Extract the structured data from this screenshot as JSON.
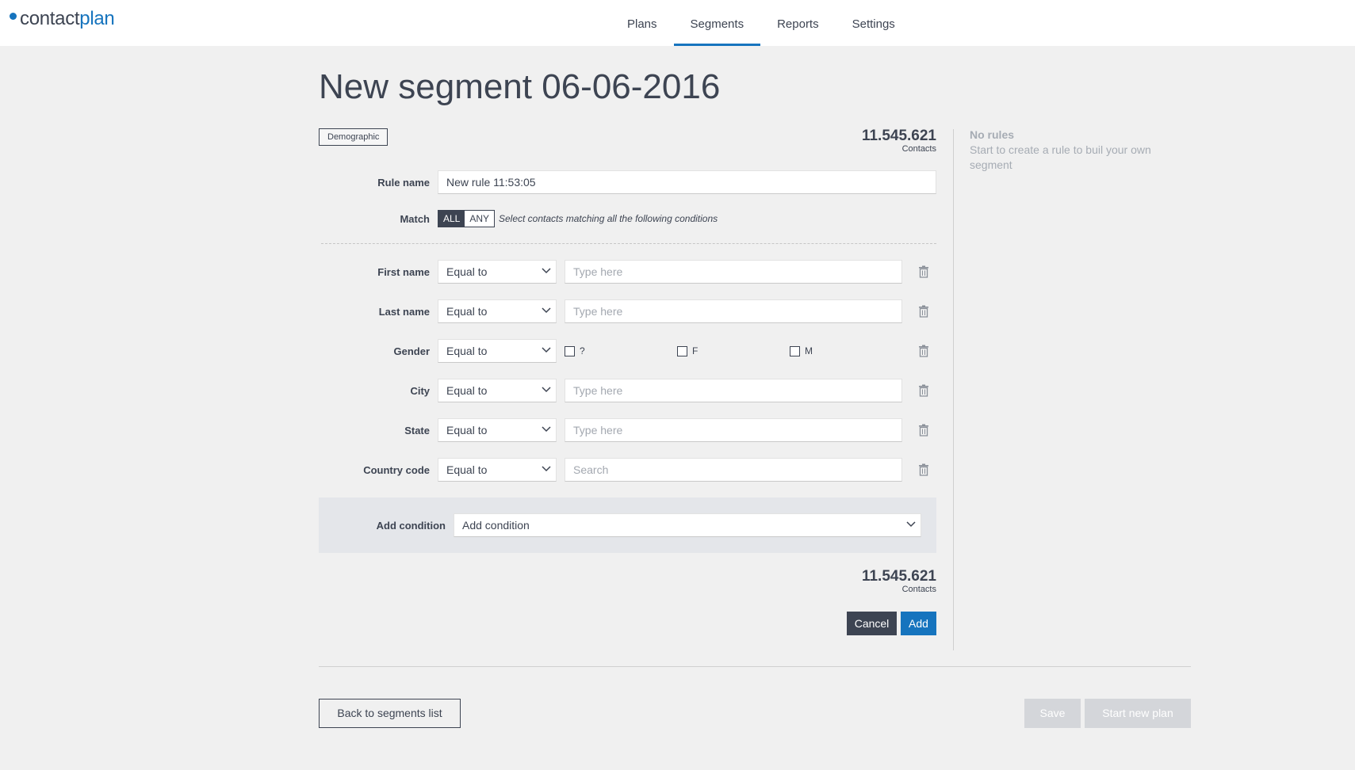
{
  "app": {
    "logo_part1": "contact",
    "logo_part2": "plan"
  },
  "nav": {
    "tabs": [
      "Plans",
      "Segments",
      "Reports",
      "Settings"
    ],
    "active": "Segments"
  },
  "page": {
    "title": "New segment 06-06-2016",
    "badge": "Demographic"
  },
  "count_top": {
    "value": "11.545.621",
    "label": "Contacts"
  },
  "count_bottom": {
    "value": "11.545.621",
    "label": "Contacts"
  },
  "side": {
    "title": "No rules",
    "text": "Start to create a rule to buil your own segment"
  },
  "rule": {
    "name_label": "Rule name",
    "name_value": "New rule 11:53:05",
    "match_label": "Match",
    "match_all": "ALL",
    "match_any": "ANY",
    "match_description": "Select contacts matching all the following conditions"
  },
  "conditions": [
    {
      "label": "First name",
      "operator": "Equal to",
      "placeholder": "Type here"
    },
    {
      "label": "Last name",
      "operator": "Equal to",
      "placeholder": "Type here"
    },
    {
      "label": "Gender",
      "operator": "Equal to",
      "options": [
        "?",
        "F",
        "M"
      ]
    },
    {
      "label": "City",
      "operator": "Equal to",
      "placeholder": "Type here"
    },
    {
      "label": "State",
      "operator": "Equal to",
      "placeholder": "Type here"
    },
    {
      "label": "Country code",
      "operator": "Equal to",
      "placeholder": "Search"
    }
  ],
  "add_condition": {
    "label": "Add condition",
    "select_value": "Add condition"
  },
  "buttons": {
    "cancel": "Cancel",
    "add": "Add",
    "back": "Back to segments list",
    "save": "Save",
    "start_new_plan": "Start new plan"
  },
  "colors": {
    "accent": "#1674be",
    "dark": "#3d4452",
    "background": "#f0f0f0"
  }
}
